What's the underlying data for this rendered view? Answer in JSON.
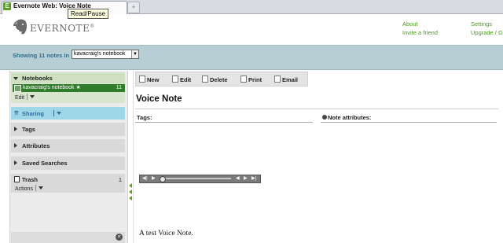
{
  "browser": {
    "tab_title": "Evernote Web: Voice Note",
    "favicon_letter": "E",
    "new_tab_symbol": "+",
    "tooltip": "Read/Pause"
  },
  "header": {
    "logo_text": "EVERNOTE",
    "logo_mark": "®",
    "links": {
      "about": "About",
      "invite": "Invite a friend",
      "settings": "Settings",
      "upgrade": "Upgrade / G"
    }
  },
  "notebook_bar": {
    "showing": "Showing 11 notes in",
    "selected_notebook": "kavacraig's notebook"
  },
  "sidebar": {
    "notebooks": {
      "label": "Notebooks",
      "items": [
        {
          "label": "kavacraig's notebook ★",
          "count": "11"
        }
      ],
      "edit_label": "Edit"
    },
    "sharing": "Sharing",
    "tags": "Tags",
    "attributes": "Attributes",
    "saved_searches": "Saved Searches",
    "trash": {
      "label": "Trash",
      "count": "1",
      "actions_label": "Actions"
    },
    "close_symbol": "×"
  },
  "toolbar": {
    "new": "New",
    "edit": "Edit",
    "delete": "Delete",
    "print": "Print",
    "email": "Email"
  },
  "note": {
    "title": "Voice Note",
    "tags_label": "Tags:",
    "attributes_label": "Note attributes:",
    "body": "A test Voice Note.",
    "player_progress": 0.0
  },
  "colors": {
    "accent_green": "#4c9a1e",
    "notebook_bar": "#b7cfd4",
    "selected_item": "#2f7d2a",
    "sharing": "#9fd6e8"
  }
}
